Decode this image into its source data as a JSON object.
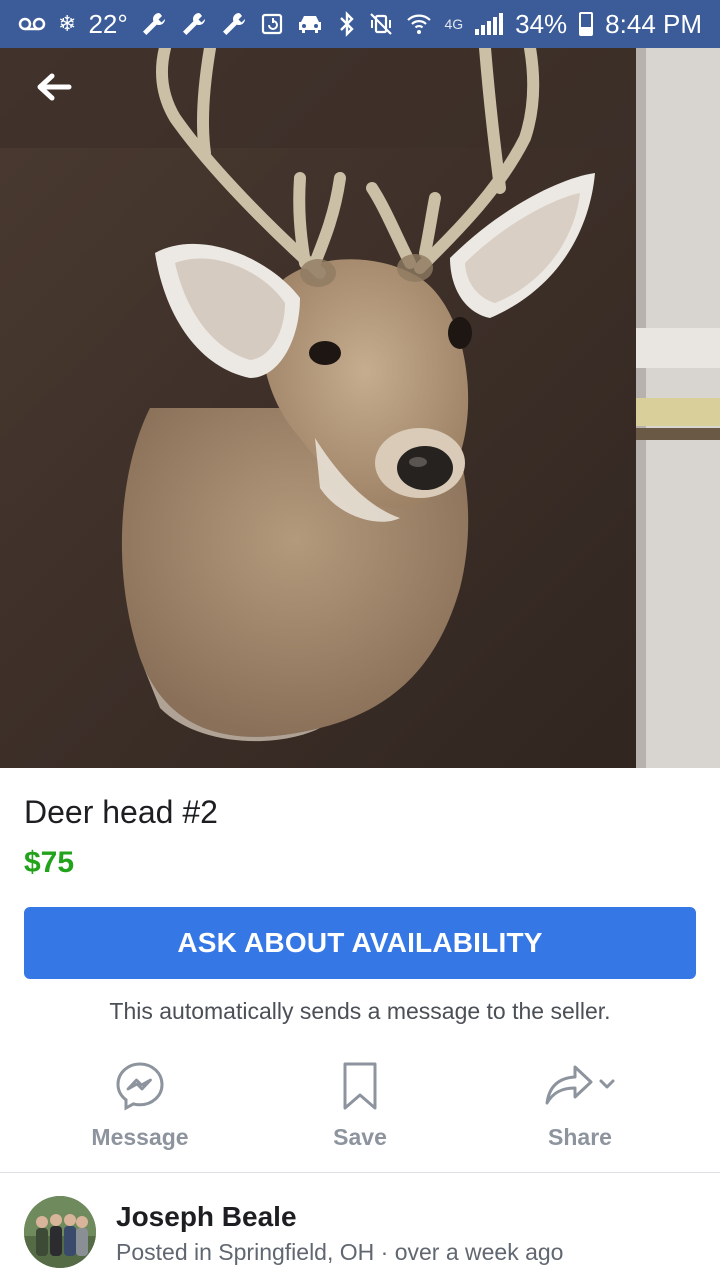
{
  "status_bar": {
    "temperature": "22°",
    "battery": "34%",
    "battery_level": 0.34,
    "time": "8:44 PM",
    "network": "4G",
    "icons_left": [
      "voicemail-icon",
      "snowflake-icon",
      "wrench-icon",
      "wrench-icon",
      "wrench-icon",
      "screenshot-icon",
      "car-icon"
    ],
    "icons_right": [
      "bluetooth-icon",
      "mute-vibrate-icon",
      "wifi-icon",
      "signal-icon"
    ]
  },
  "header": {
    "back_icon": "arrow-left-icon"
  },
  "listing": {
    "title": "Deer head #2",
    "price": "$75",
    "price_color": "#23a21b"
  },
  "ask_button": {
    "label": "ASK ABOUT AVAILABILITY",
    "color": "#3578e5"
  },
  "ask_note": "This automatically sends a message to the seller.",
  "actions": [
    {
      "label": "Message",
      "icon": "messenger-icon"
    },
    {
      "label": "Save",
      "icon": "bookmark-icon"
    },
    {
      "label": "Share",
      "icon": "share-icon"
    }
  ],
  "seller": {
    "name": "Joseph Beale",
    "location": "Posted in Springfield, OH",
    "time_ago": "over a week ago"
  }
}
